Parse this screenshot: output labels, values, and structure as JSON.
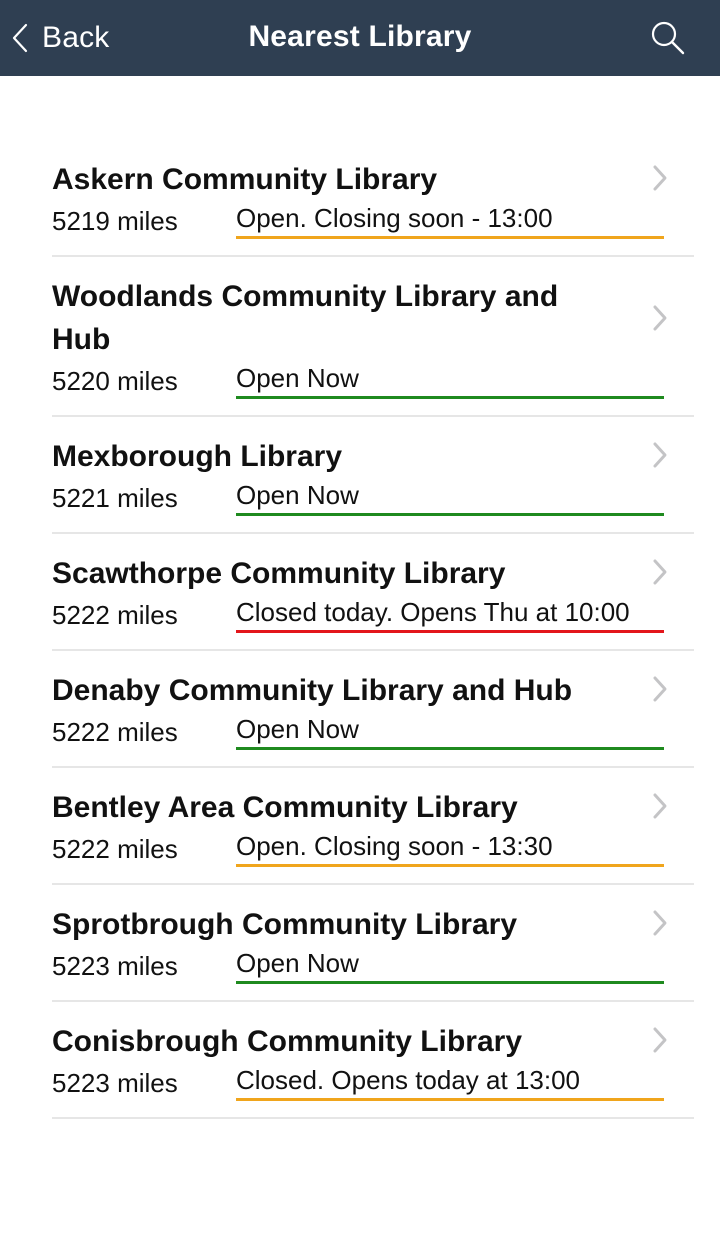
{
  "header": {
    "back_label": "Back",
    "title": "Nearest Library",
    "back_icon": "chevron-left-icon",
    "search_icon": "search-icon"
  },
  "status_colors": {
    "closing_soon": "#f0a51c",
    "open": "#1f8a1f",
    "closed": "#e3161b"
  },
  "libraries": [
    {
      "name": "Askern Community Library",
      "distance": "5219 miles",
      "status": "Open. Closing soon - 13:00",
      "status_type": "closing_soon"
    },
    {
      "name": "Woodlands Community Library and Hub",
      "distance": "5220 miles",
      "status": "Open Now",
      "status_type": "open"
    },
    {
      "name": "Mexborough Library",
      "distance": "5221 miles",
      "status": "Open Now",
      "status_type": "open"
    },
    {
      "name": "Scawthorpe Community Library",
      "distance": "5222 miles",
      "status": "Closed today. Opens Thu at 10:00",
      "status_type": "closed"
    },
    {
      "name": "Denaby Community Library and Hub",
      "distance": "5222 miles",
      "status": "Open Now",
      "status_type": "open"
    },
    {
      "name": "Bentley Area Community Library",
      "distance": "5222 miles",
      "status": "Open. Closing soon - 13:30",
      "status_type": "closing_soon"
    },
    {
      "name": "Sprotbrough Community Library",
      "distance": "5223 miles",
      "status": "Open Now",
      "status_type": "open"
    },
    {
      "name": "Conisbrough Community Library",
      "distance": "5223 miles",
      "status": "Closed. Opens today at 13:00",
      "status_type": "closing_soon"
    }
  ]
}
